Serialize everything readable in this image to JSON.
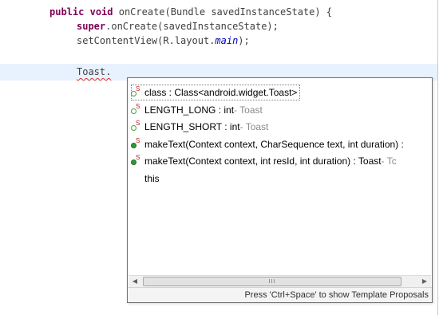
{
  "code": {
    "line1": {
      "kw1": "public",
      "kw2": "void",
      "rest": " onCreate(Bundle savedInstanceState) {"
    },
    "line2": {
      "kw": "super",
      "rest": ".onCreate(savedInstanceState);"
    },
    "line3": {
      "pre": "setContentView(R.layout.",
      "field": "main",
      "post": ");"
    },
    "line5": {
      "text": "Toast."
    }
  },
  "completion": {
    "items": [
      {
        "icon": "static-field-icon",
        "name": "class : Class<android.widget.Toast>",
        "type": ""
      },
      {
        "icon": "static-field-icon",
        "name": "LENGTH_LONG : int",
        "type": " - Toast"
      },
      {
        "icon": "static-field-icon",
        "name": "LENGTH_SHORT : int",
        "type": " - Toast"
      },
      {
        "icon": "static-method-icon",
        "name": "makeText(Context context, CharSequence text, int duration) :",
        "type": ""
      },
      {
        "icon": "static-method-icon",
        "name": "makeText(Context context, int resId, int duration) : Toast",
        "type": " - Tc"
      },
      {
        "icon": "",
        "name": "this",
        "type": ""
      }
    ],
    "scroll_left": "◀",
    "scroll_right": "▶",
    "scroll_grip": "III",
    "status": "Press 'Ctrl+Space' to show Template Proposals"
  },
  "colors": {
    "keyword": "#7f0055",
    "field_italic": "#0000c0",
    "current_line": "#e8f2fe",
    "field_icon": "#38a838",
    "method_icon": "#2e9b36"
  }
}
